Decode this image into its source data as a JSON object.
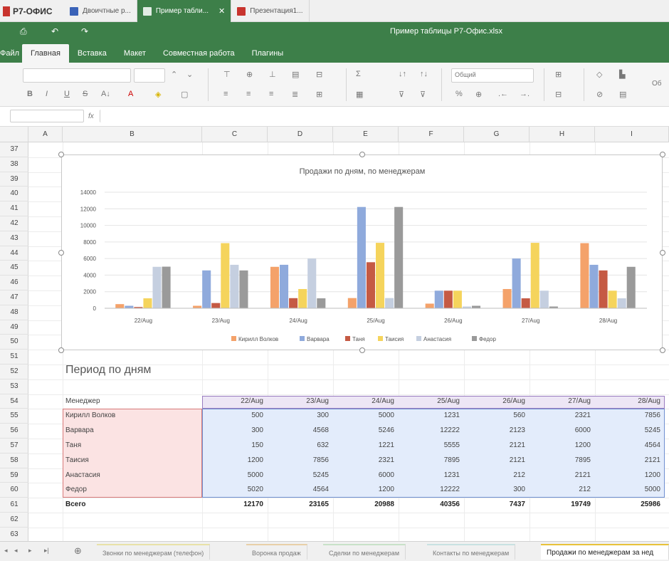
{
  "app": {
    "brand": "Р7-ОФИС"
  },
  "tabs": [
    {
      "label": "Двоичтные р...",
      "color": "#3a63b8"
    },
    {
      "label": "Пример табли...",
      "color": "#3d7f49",
      "active": true
    },
    {
      "label": "Презентация1...",
      "color": "#c8342e"
    }
  ],
  "window": {
    "title": "Пример таблицы Р7-Офис.xlsx"
  },
  "menu": [
    "Файл",
    "Главная",
    "Вставка",
    "Макет",
    "Совместная работа",
    "Плагины"
  ],
  "toolbar": {
    "number_format": "Общий",
    "extra": "Об"
  },
  "formula": {
    "fx": "fx"
  },
  "columns": [
    "A",
    "B",
    "C",
    "D",
    "E",
    "F",
    "G",
    "H",
    "I"
  ],
  "rows": [
    "37",
    "38",
    "39",
    "40",
    "41",
    "42",
    "43",
    "44",
    "45",
    "46",
    "47",
    "48",
    "49",
    "50",
    "51",
    "52",
    "53",
    "54",
    "55",
    "56",
    "57",
    "58",
    "59",
    "60",
    "61",
    "62",
    "63"
  ],
  "section_title": "Период по дням",
  "table": {
    "header_label": "Менеджер",
    "dates": [
      "22/Aug",
      "23/Aug",
      "24/Aug",
      "25/Aug",
      "26/Aug",
      "27/Aug",
      "28/Aug"
    ],
    "rows": [
      {
        "name": "Кирилл Волков",
        "values": [
          "500",
          "300",
          "5000",
          "1231",
          "560",
          "2321",
          "7856"
        ]
      },
      {
        "name": "Варвара",
        "values": [
          "300",
          "4568",
          "5246",
          "12222",
          "2123",
          "6000",
          "5245"
        ]
      },
      {
        "name": "Таня",
        "values": [
          "150",
          "632",
          "1221",
          "5555",
          "2121",
          "1200",
          "4564"
        ]
      },
      {
        "name": "Таисия",
        "values": [
          "1200",
          "7856",
          "2321",
          "7895",
          "2121",
          "7895",
          "2121"
        ]
      },
      {
        "name": "Анастасия",
        "values": [
          "5000",
          "5245",
          "6000",
          "1231",
          "212",
          "2121",
          "1200"
        ]
      },
      {
        "name": "Федор",
        "values": [
          "5020",
          "4564",
          "1200",
          "12222",
          "300",
          "212",
          "5000"
        ]
      }
    ],
    "total_label": "Всего",
    "totals": [
      "12170",
      "23165",
      "20988",
      "40356",
      "7437",
      "19749",
      "25986"
    ]
  },
  "sheets": [
    "Звонки по менеджерам (телефон)",
    "Воронка продаж",
    "Сделки по менеджерам",
    "Контакты по менеджерам",
    "Продажи по менеджерам за нед"
  ],
  "chart_data": {
    "type": "bar",
    "title": "Продажи по дням, по менеджерам",
    "categories": [
      "22/Aug",
      "23/Aug",
      "24/Aug",
      "25/Aug",
      "26/Aug",
      "27/Aug",
      "28/Aug"
    ],
    "ylim": [
      0,
      14000
    ],
    "yticks": [
      "0",
      "2000",
      "4000",
      "6000",
      "8000",
      "10000",
      "12000",
      "14000"
    ],
    "legend": "bottom",
    "grid": true,
    "series": [
      {
        "name": "Кирилл Волков",
        "color": "#f4a26a",
        "values": [
          500,
          300,
          5000,
          1231,
          560,
          2321,
          7856
        ]
      },
      {
        "name": "Варвара",
        "color": "#8faadc",
        "values": [
          300,
          4568,
          5246,
          12222,
          2123,
          6000,
          5245
        ]
      },
      {
        "name": "Таня",
        "color": "#c55a44",
        "values": [
          150,
          632,
          1221,
          5555,
          2121,
          1200,
          4564
        ]
      },
      {
        "name": "Таисия",
        "color": "#f5d45c",
        "values": [
          1200,
          7856,
          2321,
          7895,
          2121,
          7895,
          2121
        ]
      },
      {
        "name": "Анастасия",
        "color": "#c5cfe0",
        "values": [
          5000,
          5245,
          6000,
          1231,
          212,
          2121,
          1200
        ]
      },
      {
        "name": "Федор",
        "color": "#9a9a9a",
        "values": [
          5020,
          4564,
          1200,
          12222,
          300,
          212,
          5000
        ]
      }
    ]
  }
}
